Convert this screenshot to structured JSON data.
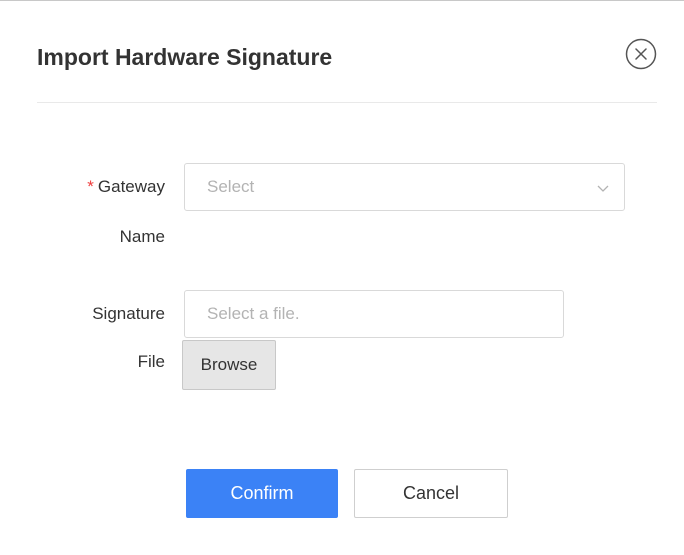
{
  "dialog": {
    "title": "Import Hardware Signature",
    "close_icon": "close-circle-icon"
  },
  "form": {
    "gateway": {
      "required_mark": "*",
      "label_line1": "Gateway",
      "label_line2": "Name",
      "placeholder": "Select",
      "chevron_icon": "chevron-down-icon"
    },
    "signature": {
      "label_line1": "Signature",
      "label_line2": "File",
      "placeholder": "Select a file.",
      "value": "",
      "browse_label": "Browse"
    }
  },
  "footer": {
    "confirm_label": "Confirm",
    "cancel_label": "Cancel"
  },
  "colors": {
    "primary": "#3b82f6",
    "required": "#ee3b3b",
    "placeholder": "#b3b3b3"
  }
}
